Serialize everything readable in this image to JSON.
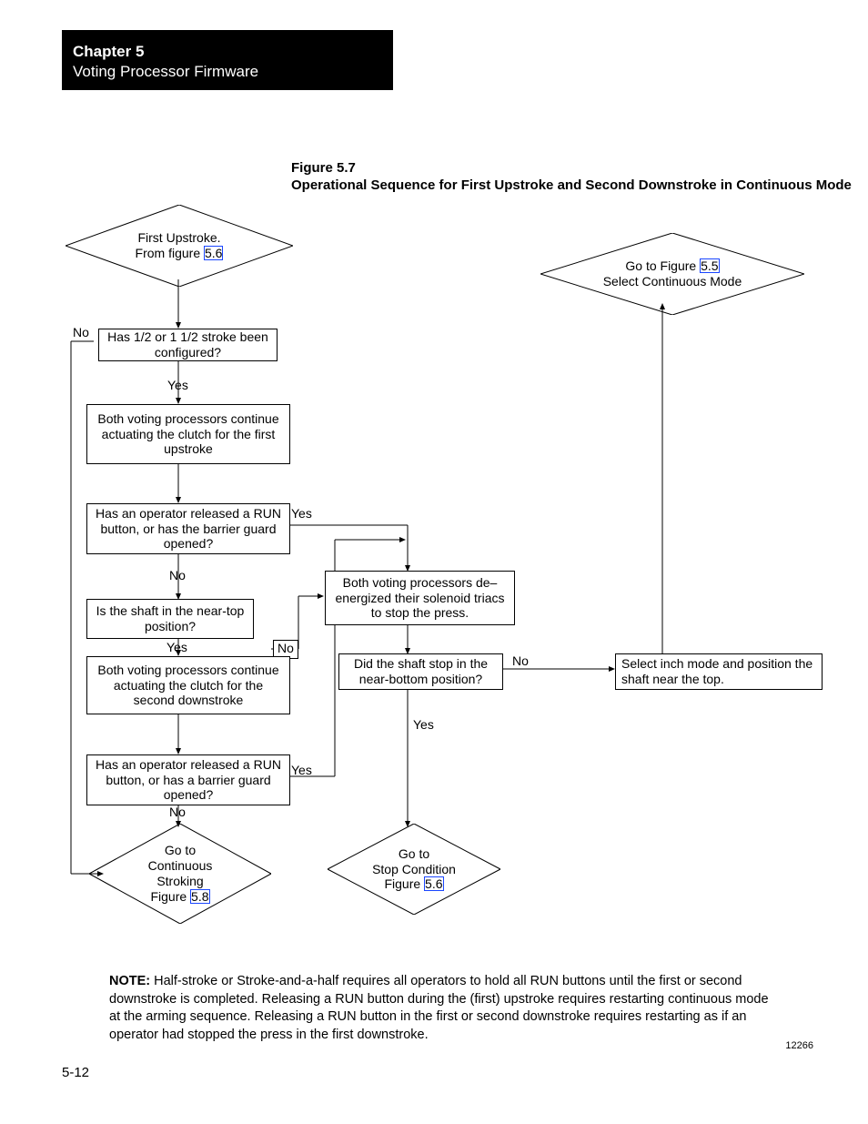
{
  "header": {
    "chapter_no": "Chapter 5",
    "chapter_title": "Voting Processor Firmware"
  },
  "figure": {
    "number": "Figure 5.7",
    "title": "Operational Sequence for First Upstroke and Second Downstroke in Continuous Mode"
  },
  "diagram": {
    "start": {
      "line1": "First Upstroke.",
      "line2_pre": "From figure",
      "line2_link": "5.6"
    },
    "goto_select": {
      "line1_pre": "Go to Figure",
      "line1_link": "5.5",
      "line2": "Select Continuous Mode"
    },
    "q_stroke_cfg": "Has 1/2 or 1 1/2 stroke been configured?",
    "p_upstroke": "Both voting processors continue actuating the clutch for the first upstroke",
    "q_run1": "Has an operator released a RUN button, or has the barrier guard opened?",
    "q_near_top": "Is the shaft in the near-top position?",
    "p_downstroke": "Both voting processors continue actuating the clutch for the second downstroke",
    "q_run2": "Has an operator released a RUN button, or has a barrier guard opened?",
    "p_deenergize": "Both voting processors de–energized their solenoid triacs to stop the press.",
    "q_near_bottom": "Did the shaft stop in the near-bottom position?",
    "p_inch": "Select inch mode and position the shaft near the top.",
    "goto_cont": {
      "line1": "Go to",
      "line2": "Continuous",
      "line3": "Stroking",
      "line4_pre": "Figure",
      "line4_link": "5.8"
    },
    "goto_stop": {
      "line1": "Go to",
      "line2": "Stop Condition",
      "line3_pre": "Figure",
      "line3_link": "5.6"
    },
    "labels": {
      "yes": "Yes",
      "no": "No"
    }
  },
  "note": {
    "label": "NOTE:",
    "text": "Half-stroke or Stroke-and-a-half requires all operators to hold all RUN buttons until the first or second downstroke is completed. Releasing a RUN button during the (first) upstroke requires restarting continuous mode at the arming sequence. Releasing a RUN button in the first or second downstroke requires restarting as if an operator had stopped the press in the first downstroke."
  },
  "page_number": "5-12",
  "figure_id": "12266"
}
